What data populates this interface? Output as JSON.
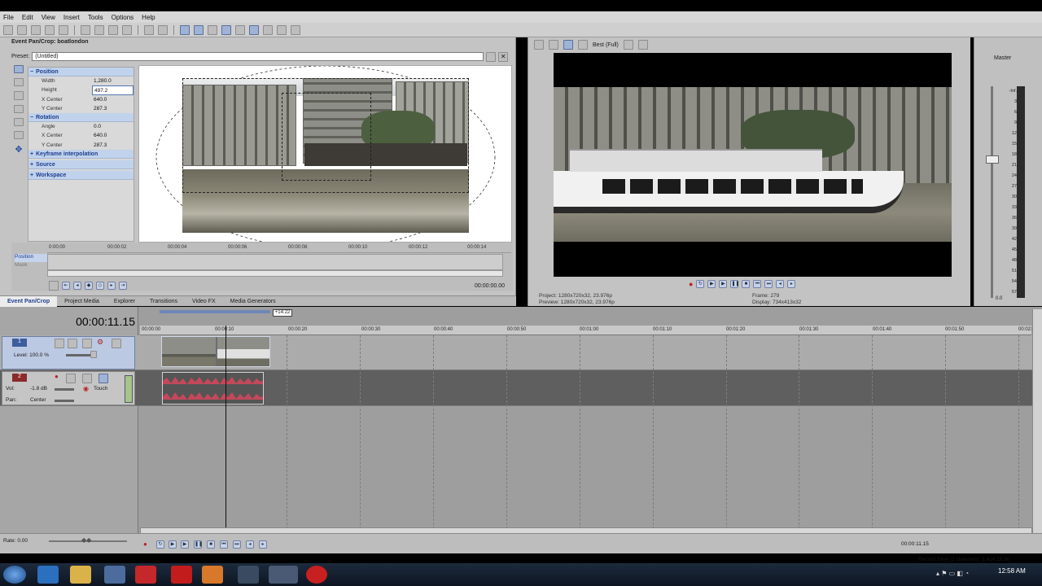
{
  "menu": [
    "File",
    "Edit",
    "View",
    "Insert",
    "Tools",
    "Options",
    "Help"
  ],
  "pancrop": {
    "title": "Event Pan/Crop: boatlondon",
    "preset_label": "Preset:",
    "preset_value": "(Untitled)",
    "sections": {
      "position": "Position",
      "rotation": "Rotation",
      "keyframe": "Keyframe interpolation",
      "source": "Source",
      "workspace": "Workspace"
    },
    "props": {
      "width_k": "Width",
      "width_v": "1,280.0",
      "height_k": "Height",
      "height_v": "497.2",
      "xc_k": "X Center",
      "xc_v": "640.0",
      "yc_k": "Y Center",
      "yc_v": "287.3",
      "angle_k": "Angle",
      "angle_v": "0.0",
      "rxc_k": "X Center",
      "rxc_v": "640.0",
      "ryc_k": "Y Center",
      "ryc_v": "287.3"
    },
    "ruler": [
      "0:00:00",
      "00:00:02",
      "00:00:04",
      "00:00:06",
      "00:00:08",
      "00:00:10",
      "00:00:12",
      "00:00:14"
    ],
    "position_lbl": "Position",
    "mask_lbl": "Mask",
    "time": "00:00:00.00"
  },
  "tabs": [
    "Event Pan/Crop",
    "Project Media",
    "Explorer",
    "Transitions",
    "Video FX",
    "Media Generators"
  ],
  "preview": {
    "quality": "Best (Full)",
    "project_label": "Project:",
    "project_value": "1280x720x32, 23.976p",
    "preview_label": "Preview:",
    "preview_value": "1280x720x32, 23.976p",
    "frame_label": "Frame:",
    "frame_value": "279",
    "display_label": "Display:",
    "display_value": "734x413x32"
  },
  "master": {
    "label": "Master",
    "scale": [
      "-Inf.",
      "3",
      "6",
      "9",
      "12",
      "15",
      "18",
      "21",
      "24",
      "27",
      "30",
      "33",
      "36",
      "39",
      "42",
      "45",
      "48",
      "51",
      "54",
      "57"
    ],
    "bottom": "0.0"
  },
  "timeline": {
    "timecode": "00:00:11.15",
    "marker": "+14:22",
    "ruler": [
      "00:00:00",
      "00:00:10",
      "00:00:20",
      "00:00:30",
      "00:00:40",
      "00:00:50",
      "00:01:00",
      "00:01:10",
      "00:01:20",
      "00:01:30",
      "00:01:40",
      "00:01:50",
      "00:02:00"
    ],
    "video_track_num": "1",
    "video_level": "Level: 100.0 %",
    "audio_track_num": "2",
    "audio_vol": "Vol:",
    "audio_vol_value": "-1.8 dB",
    "audio_pan": "Pan:",
    "audio_pan_value": "Center",
    "touch": "Touch",
    "rate": "Rate: 0.00",
    "bottom_time": "00:00:11.15",
    "record_time": "Record Time (2 channels): 1,414:15:30"
  },
  "clock": "12:58 AM"
}
